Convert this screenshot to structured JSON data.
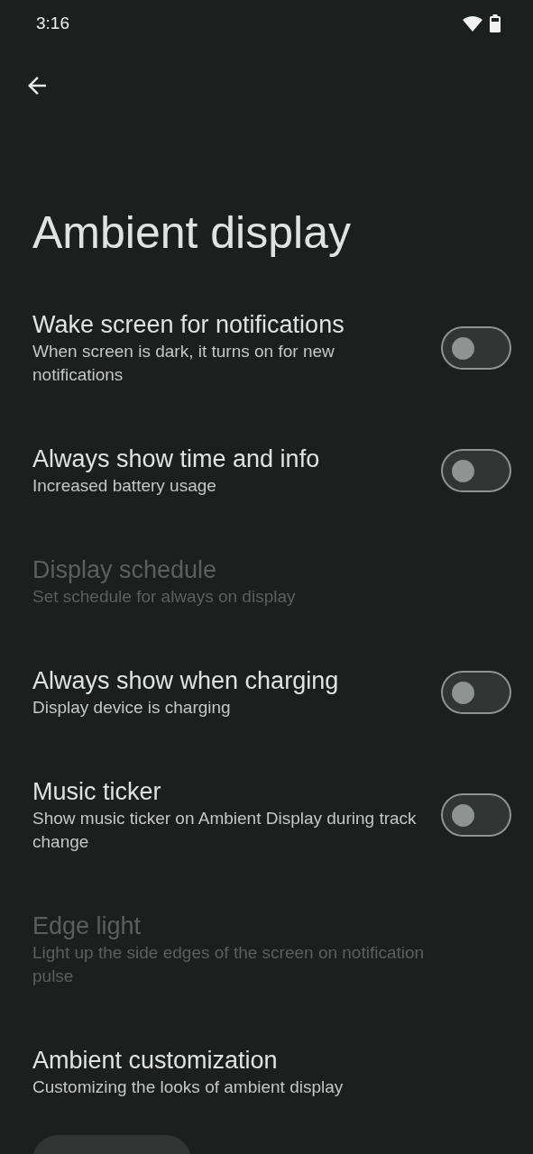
{
  "status_bar": {
    "time": "3:16"
  },
  "title": "Ambient display",
  "settings": [
    {
      "kind": "toggle",
      "title": "Wake screen for notifications",
      "subtitle": "When screen is dark, it turns on for new notifications",
      "on": false,
      "disabled": false
    },
    {
      "kind": "toggle",
      "title": "Always show time and info",
      "subtitle": "Increased battery usage",
      "on": false,
      "disabled": false
    },
    {
      "kind": "text",
      "title": "Display schedule",
      "subtitle": "Set schedule for always on display",
      "disabled": true
    },
    {
      "kind": "toggle",
      "title": "Always show when charging",
      "subtitle": "Display device is charging",
      "on": false,
      "disabled": false
    },
    {
      "kind": "toggle",
      "title": "Music ticker",
      "subtitle": "Show music ticker on Ambient Display during track change",
      "on": false,
      "disabled": false
    },
    {
      "kind": "text",
      "title": "Edge light",
      "subtitle": "Light up the side edges of the screen on notification pulse",
      "disabled": true
    },
    {
      "kind": "text",
      "title": "Ambient customization",
      "subtitle": "Customizing the looks of ambient display",
      "disabled": false
    }
  ],
  "partial_button": true
}
